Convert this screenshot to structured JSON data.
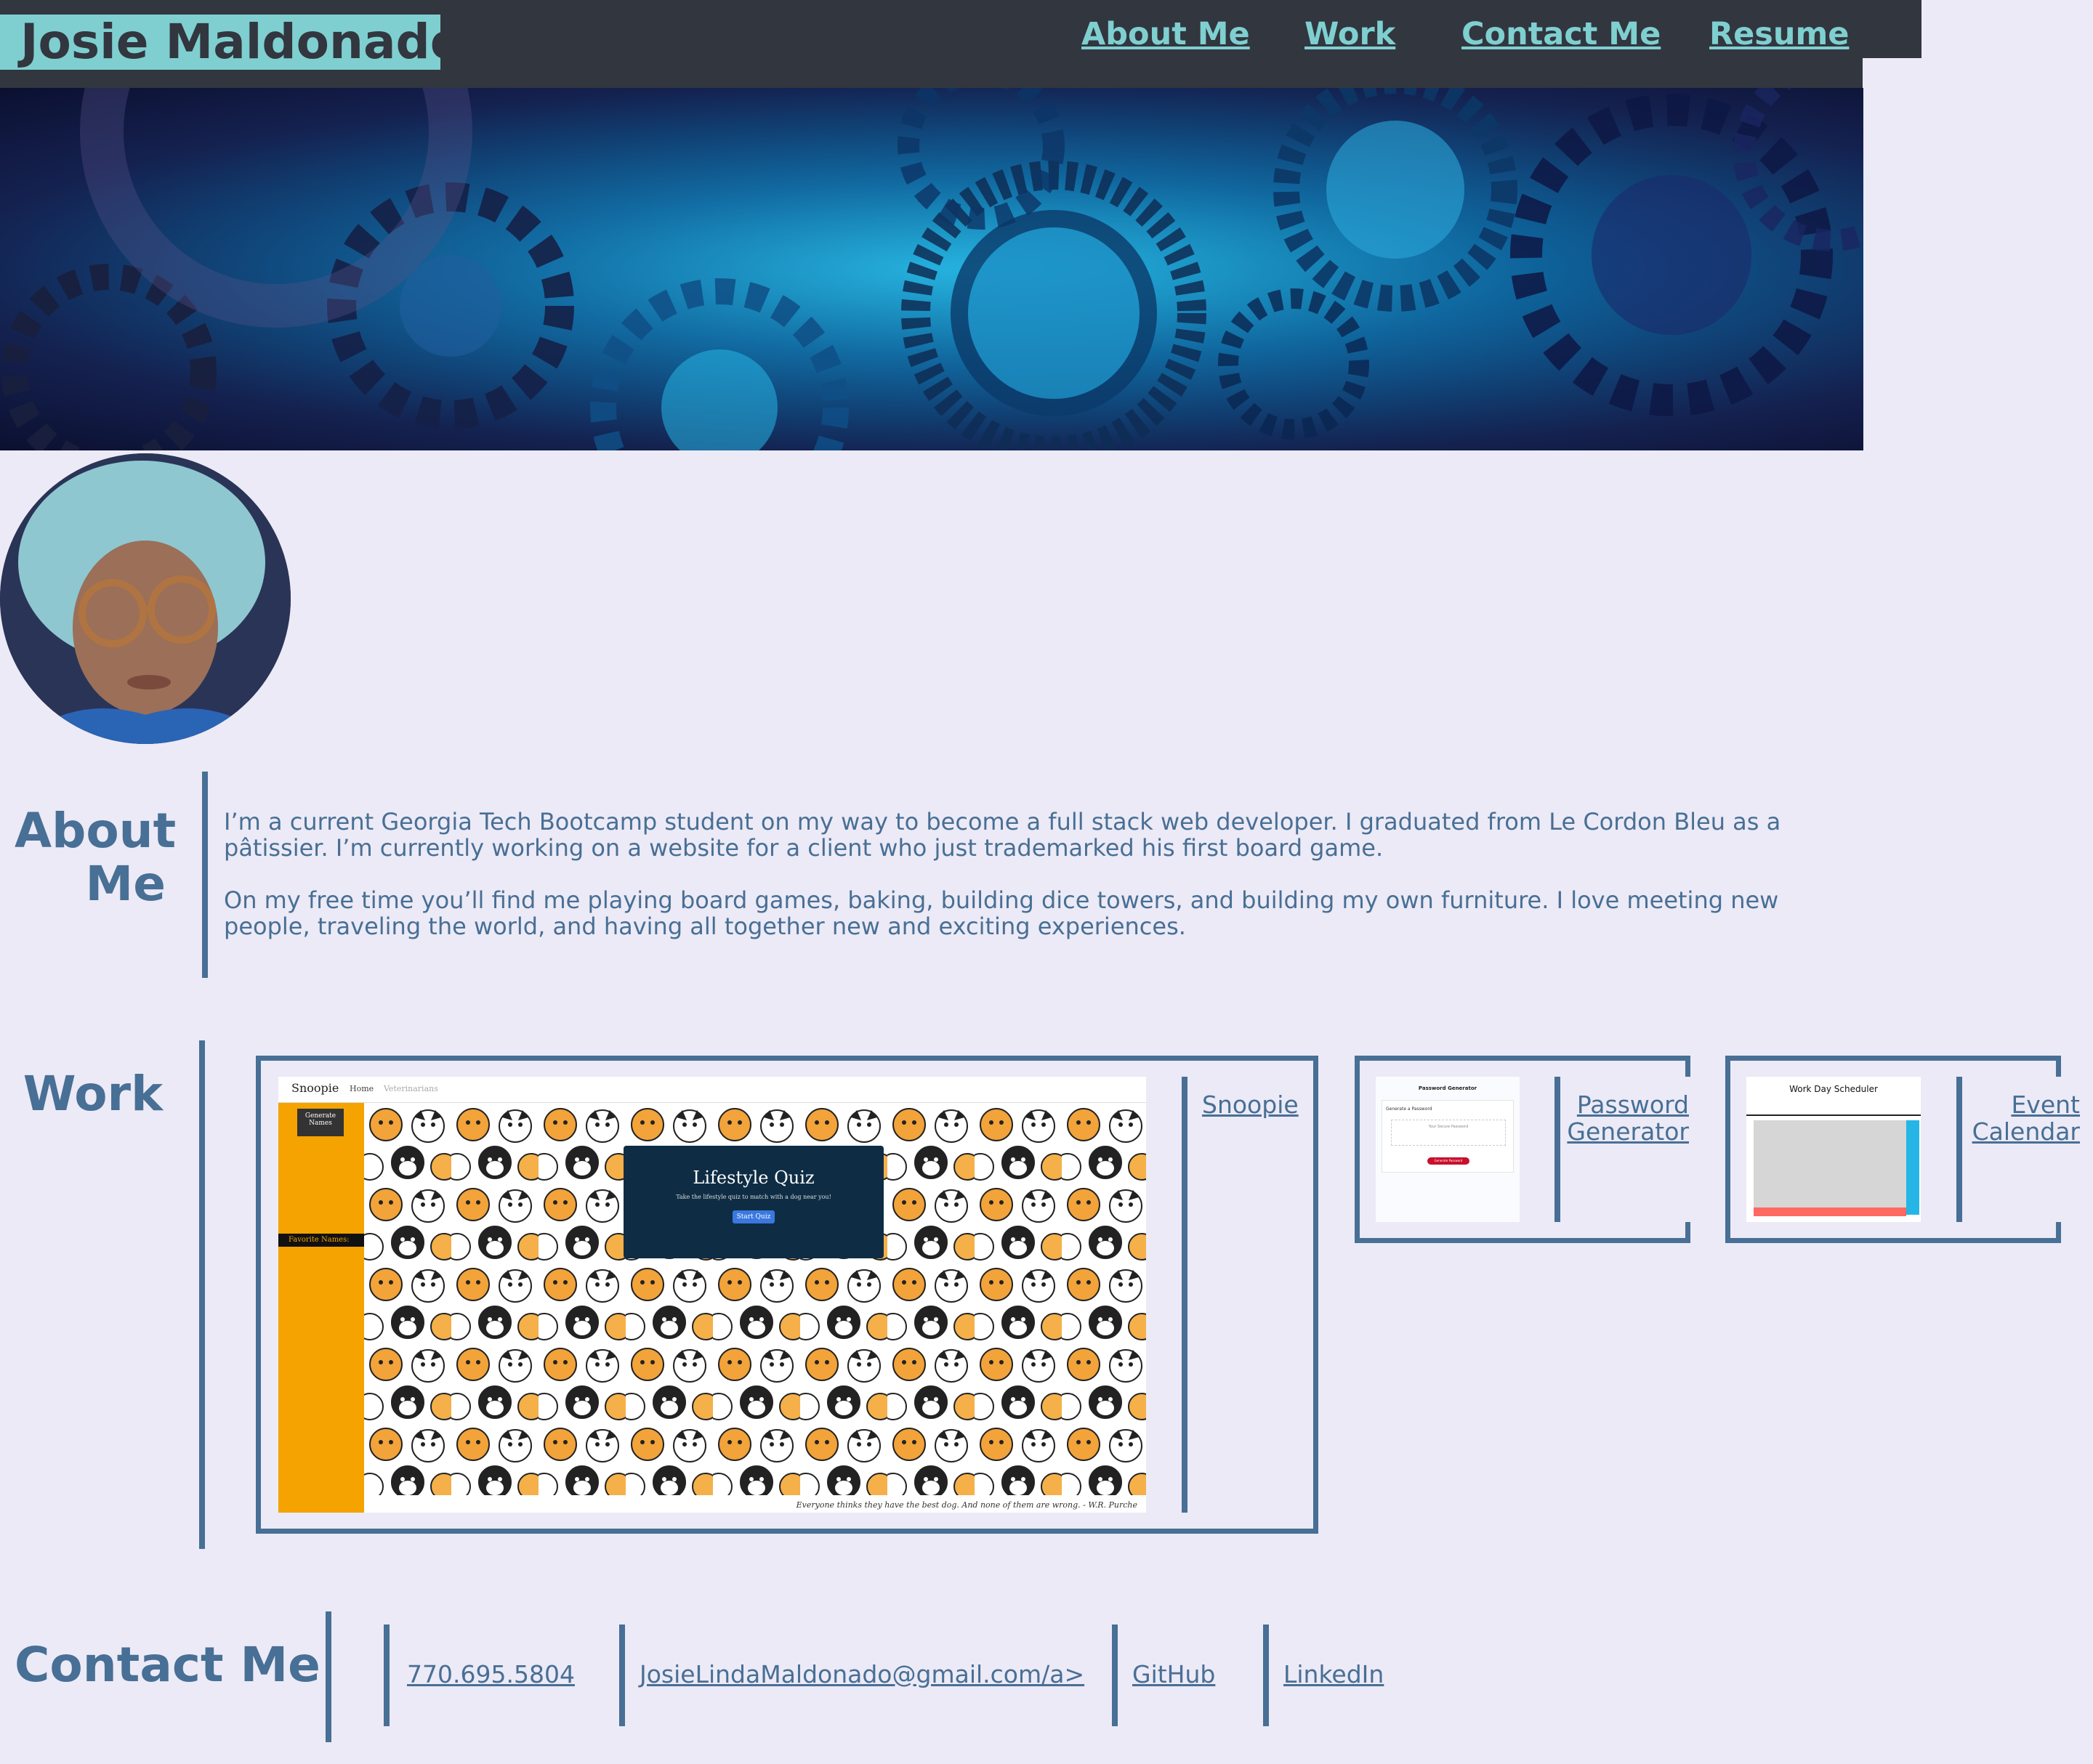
{
  "header": {
    "brand": "Josie Maldonado",
    "nav": [
      "About Me",
      "Work",
      "Contact Me",
      "Resume"
    ]
  },
  "about": {
    "title_line1": "About",
    "title_line2": "Me",
    "paragraph1": "I’m a current Georgia Tech Bootcamp student on my way to become a full stack web developer. I graduated from Le Cordon Bleu as a pâtissier. I’m currently working on a website for a client who just trademarked his first board game.",
    "paragraph2": "On my free time you’ll find me playing board games, baking, building dice towers, and building my own furniture. I love meeting new people, traveling the world, and having all together new and exciting experiences."
  },
  "work": {
    "title": "Work",
    "projects": [
      {
        "link": "Snoopie",
        "screenshot": {
          "site_name": "Snoopie",
          "nav_home": "Home",
          "nav_vets": "Veterinarians",
          "sidebar_button": "Generate Names",
          "sidebar_label": "Favorite Names:",
          "quiz_title": "Lifestyle Quiz",
          "quiz_subtitle": "Take the lifestyle quiz to match with a dog near you!",
          "quiz_button": "Start Quiz",
          "quote": "Everyone thinks they have the best dog. And none of them are wrong. - W.R. Purche"
        }
      },
      {
        "link_line1": "Password",
        "link_line2": "Generator",
        "screenshot": {
          "title": "Password Generator",
          "subtitle": "Generate a Password",
          "field": "Your Secure Password",
          "button": "Generate Password"
        }
      },
      {
        "link_line1": "Event",
        "link_line2": "Calendar",
        "screenshot": {
          "title": "Work Day Scheduler"
        }
      }
    ]
  },
  "contact": {
    "title": "Contact Me",
    "phone": "770.695.5804",
    "email": "JosieLindaMaldonado@gmail.com/a>",
    "github": "GitHub",
    "linkedin": "LinkedIn"
  },
  "colors": {
    "page_bg": "#eceaf6",
    "header_bg": "#32363f",
    "accent_teal": "#7fcfd0",
    "text_blue": "#486f95",
    "snoopie_orange": "#f5a300",
    "quiz_navy": "#0e2d45"
  }
}
